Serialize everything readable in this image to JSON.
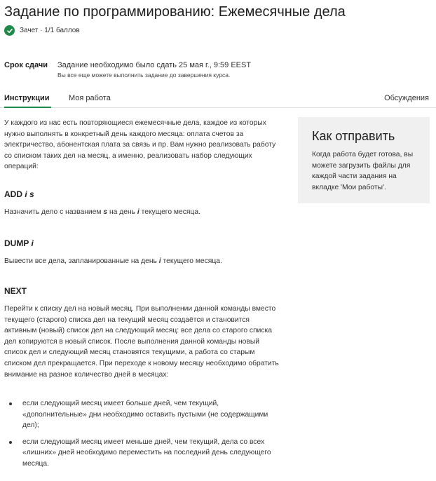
{
  "page": {
    "title": "Задание по программированию: Ежемесячные дела",
    "status": "Зачет · 1/1 баллов"
  },
  "due": {
    "label": "Срок сдачи",
    "text": "Задание необходимо было сдать 25 мая г., 9:59 EEST",
    "subtext": "Вы все еще можете выполнить задание до завершения курса."
  },
  "tabs": {
    "instructions": "Инструкции",
    "my_work": "Моя работа",
    "discussions": "Обсуждения"
  },
  "content": {
    "intro": "У каждого из нас есть повторяющиеся ежемесячные дела, каждое из которых нужно выполнять в конкретный день каждого месяца: оплата счетов за электричество, абонентская плата за связь и пр. Вам нужно реализовать работу со списком таких дел на месяц, а именно, реализовать набор следующих операций:",
    "add": {
      "name": "ADD",
      "args": "i s",
      "desc_1": "Назначить дело с названием ",
      "desc_s": "s",
      "desc_2": " на день ",
      "desc_i": "i",
      "desc_3": " текущего месяца."
    },
    "dump": {
      "name": "DUMP",
      "args": "i",
      "desc_1": "Вывести все дела, запланированные на день ",
      "desc_i": "i",
      "desc_2": " текущего месяца."
    },
    "next": {
      "name": "NEXT",
      "desc": "Перейти к списку дел на новый месяц. При выполнении данной команды вместо текущего (старого) списка дел на текущий месяц создаётся и становится активным (новый) список дел на следующий месяц: все дела со старого списка дел копируются в новый список. После выполнения данной команды новый список дел и следующий месяц становятся текущими, а работа со старым списком дел прекращается. При переходе к новому месяцу необходимо обратить внимание на разное количество дней в месяцах:",
      "bullets": [
        "если следующий месяц имеет больше дней, чем текущий, «дополнительные» дни необходимо оставить пустыми (не содержащими дел);",
        "если следующий месяц имеет меньше дней, чем текущий, дела со всех «лишних» дней необходимо переместить на последний день следующего месяца."
      ]
    }
  },
  "side": {
    "title": "Как отправить",
    "text": "Когда работа будет готова, вы можете загрузить файлы для каждой части задания на вкладке 'Мои работы'."
  },
  "colors": {
    "accent": "#1e8a4a",
    "side_bg": "#f0f0f0"
  }
}
